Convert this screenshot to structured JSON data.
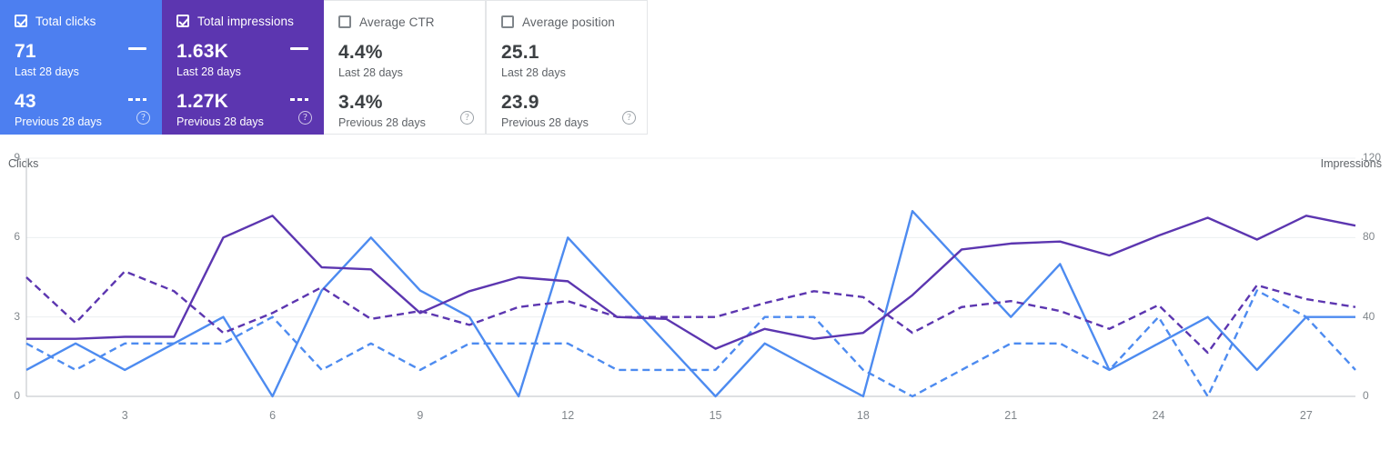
{
  "cards": [
    {
      "id": "total-clicks",
      "label": "Total clicks",
      "checked": true,
      "style": "selected-blue",
      "current_value": "71",
      "current_label": "Last 28 days",
      "previous_value": "43",
      "previous_label": "Previous 28 days",
      "help": "?"
    },
    {
      "id": "total-impressions",
      "label": "Total impressions",
      "checked": true,
      "style": "selected-purple",
      "current_value": "1.63K",
      "current_label": "Last 28 days",
      "previous_value": "1.27K",
      "previous_label": "Previous 28 days",
      "help": "?"
    },
    {
      "id": "average-ctr",
      "label": "Average CTR",
      "checked": false,
      "style": "plain",
      "current_value": "4.4%",
      "current_label": "Last 28 days",
      "previous_value": "3.4%",
      "previous_label": "Previous 28 days",
      "help": "?"
    },
    {
      "id": "average-position",
      "label": "Average position",
      "checked": false,
      "style": "plain",
      "current_value": "25.1",
      "current_label": "Last 28 days",
      "previous_value": "23.9",
      "previous_label": "Previous 28 days",
      "help": "?"
    }
  ],
  "colors": {
    "clicks": "#4d8bf0",
    "impressions": "#5c36b0",
    "card_blue": "#4d7ff0",
    "card_purple": "#5c36b0",
    "grid": "#eceff1",
    "axis_text": "#80868b"
  },
  "chart_data": {
    "type": "line",
    "title": "",
    "xlabel": "",
    "grid": true,
    "legend_position": "cards-above",
    "x": [
      1,
      2,
      3,
      4,
      5,
      6,
      7,
      8,
      9,
      10,
      11,
      12,
      13,
      14,
      15,
      16,
      17,
      18,
      19,
      20,
      21,
      22,
      23,
      24,
      25,
      26,
      27,
      28
    ],
    "xticks": [
      "3",
      "6",
      "9",
      "12",
      "15",
      "18",
      "21",
      "24",
      "27"
    ],
    "axes": [
      {
        "name": "Clicks",
        "side": "left",
        "ticks": [
          "0",
          "3",
          "6",
          "9"
        ],
        "min": 0,
        "max": 9
      },
      {
        "name": "Impressions",
        "side": "right",
        "ticks": [
          "0",
          "40",
          "80",
          "120"
        ],
        "min": 0,
        "max": 120
      }
    ],
    "series": [
      {
        "name": "Total clicks",
        "axis": "Clicks",
        "style": "solid",
        "color": "#4d8bf0",
        "values": [
          1,
          2,
          1,
          2,
          3,
          0,
          4,
          6,
          4,
          3,
          0,
          6,
          4,
          2,
          0,
          2,
          1,
          0,
          7,
          5,
          3,
          5,
          1,
          2,
          3,
          1,
          3,
          3
        ]
      },
      {
        "name": "Total clicks (previous)",
        "axis": "Clicks",
        "style": "dashed",
        "color": "#4d8bf0",
        "values": [
          2,
          1,
          2,
          2,
          2,
          3,
          1,
          2,
          1,
          2,
          2,
          2,
          1,
          1,
          1,
          3,
          3,
          1,
          0,
          1,
          2,
          2,
          1,
          3,
          0,
          4,
          3,
          1
        ]
      },
      {
        "name": "Total impressions",
        "axis": "Impressions",
        "style": "solid",
        "color": "#5c36b0",
        "values": [
          29,
          29,
          30,
          30,
          80,
          91,
          65,
          64,
          42,
          53,
          60,
          58,
          40,
          39,
          24,
          34,
          29,
          32,
          51,
          74,
          77,
          78,
          71,
          81,
          90,
          79,
          91,
          86
        ]
      },
      {
        "name": "Total impressions (previous)",
        "axis": "Impressions",
        "style": "dashed",
        "color": "#5c36b0",
        "values": [
          60,
          37,
          63,
          53,
          32,
          42,
          55,
          39,
          43,
          36,
          45,
          48,
          40,
          40,
          40,
          47,
          53,
          50,
          32,
          45,
          48,
          43,
          34,
          46,
          22,
          56,
          49,
          45
        ]
      }
    ]
  }
}
